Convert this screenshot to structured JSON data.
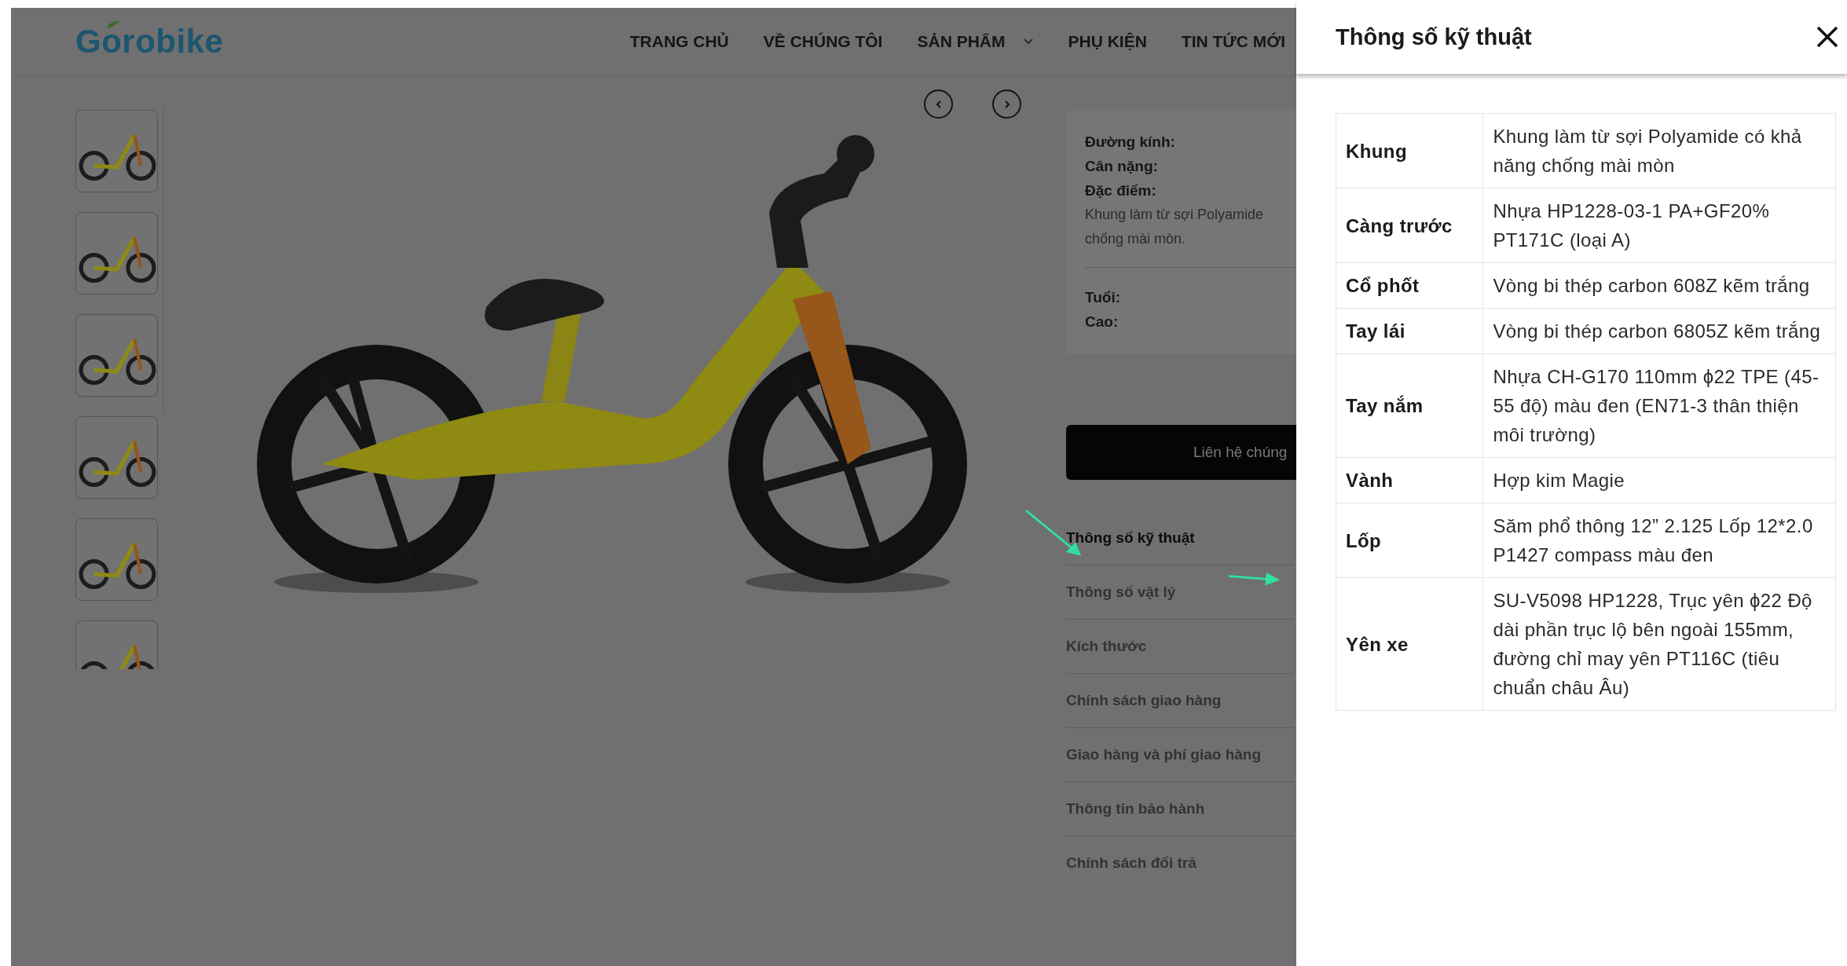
{
  "header": {
    "logo": "Gorobike",
    "nav": [
      {
        "label": "TRANG CHỦ",
        "dropdown": false
      },
      {
        "label": "VỀ CHÚNG TÔI",
        "dropdown": false
      },
      {
        "label": "SẢN PHẨM",
        "dropdown": true
      },
      {
        "label": "PHỤ KIỆN",
        "dropdown": false
      },
      {
        "label": "TIN TỨC MỚI",
        "dropdown": false
      }
    ]
  },
  "info_card": {
    "fields": [
      "Đường kính:",
      "Cân nặng:",
      "Đặc điểm:"
    ],
    "description_lines": [
      "Khung làm từ sợi Polyamide",
      "chống mài mòn."
    ],
    "fields_2": [
      "Tuổi:",
      "Cao:"
    ]
  },
  "contact_button": "Liên hệ chúng",
  "tabs": [
    {
      "label": "Thông số kỹ thuật",
      "selected": true
    },
    {
      "label": "Thông số vật lý",
      "selected": false
    },
    {
      "label": "Kích thước",
      "selected": false
    },
    {
      "label": "Chính sách giao hàng",
      "selected": false
    },
    {
      "label": "Giao hàng và phí giao hàng",
      "selected": false
    },
    {
      "label": "Thông tin bảo hành",
      "selected": false
    },
    {
      "label": "Chính sách đổi trả",
      "selected": false
    }
  ],
  "panel": {
    "title": "Thông số kỹ thuật",
    "rows": [
      {
        "label": "Khung",
        "value": "Khung làm từ sợi Polyamide có khả năng chống mài mòn"
      },
      {
        "label": "Càng trước",
        "value": "Nhựa HP1228-03-1 PA+GF20% PT171C (loại A)"
      },
      {
        "label": "Cổ phốt",
        "value": "Vòng bi thép carbon 608Z kẽm trắng"
      },
      {
        "label": "Tay lái",
        "value": "Vòng bi thép carbon 6805Z kẽm trắng"
      },
      {
        "label": "Tay nắm",
        "value": "Nhựa CH-G170 110mm ϕ22 TPE (45-55 độ) màu đen (EN71-3 thân thiện môi trường)"
      },
      {
        "label": "Vành",
        "value": "Hợp kim Magie"
      },
      {
        "label": "Lốp",
        "value": "Săm phổ thông 12” 2.125 Lốp 12*2.0 P1427 compass màu đen"
      },
      {
        "label": "Yên xe",
        "value": "SU-V5098 HP1228, Trục yên ϕ22 Độ dài phần trục lộ bên ngoài 155mm, đường chỉ may yên PT116C (tiêu chuẩn châu Âu)"
      }
    ]
  }
}
